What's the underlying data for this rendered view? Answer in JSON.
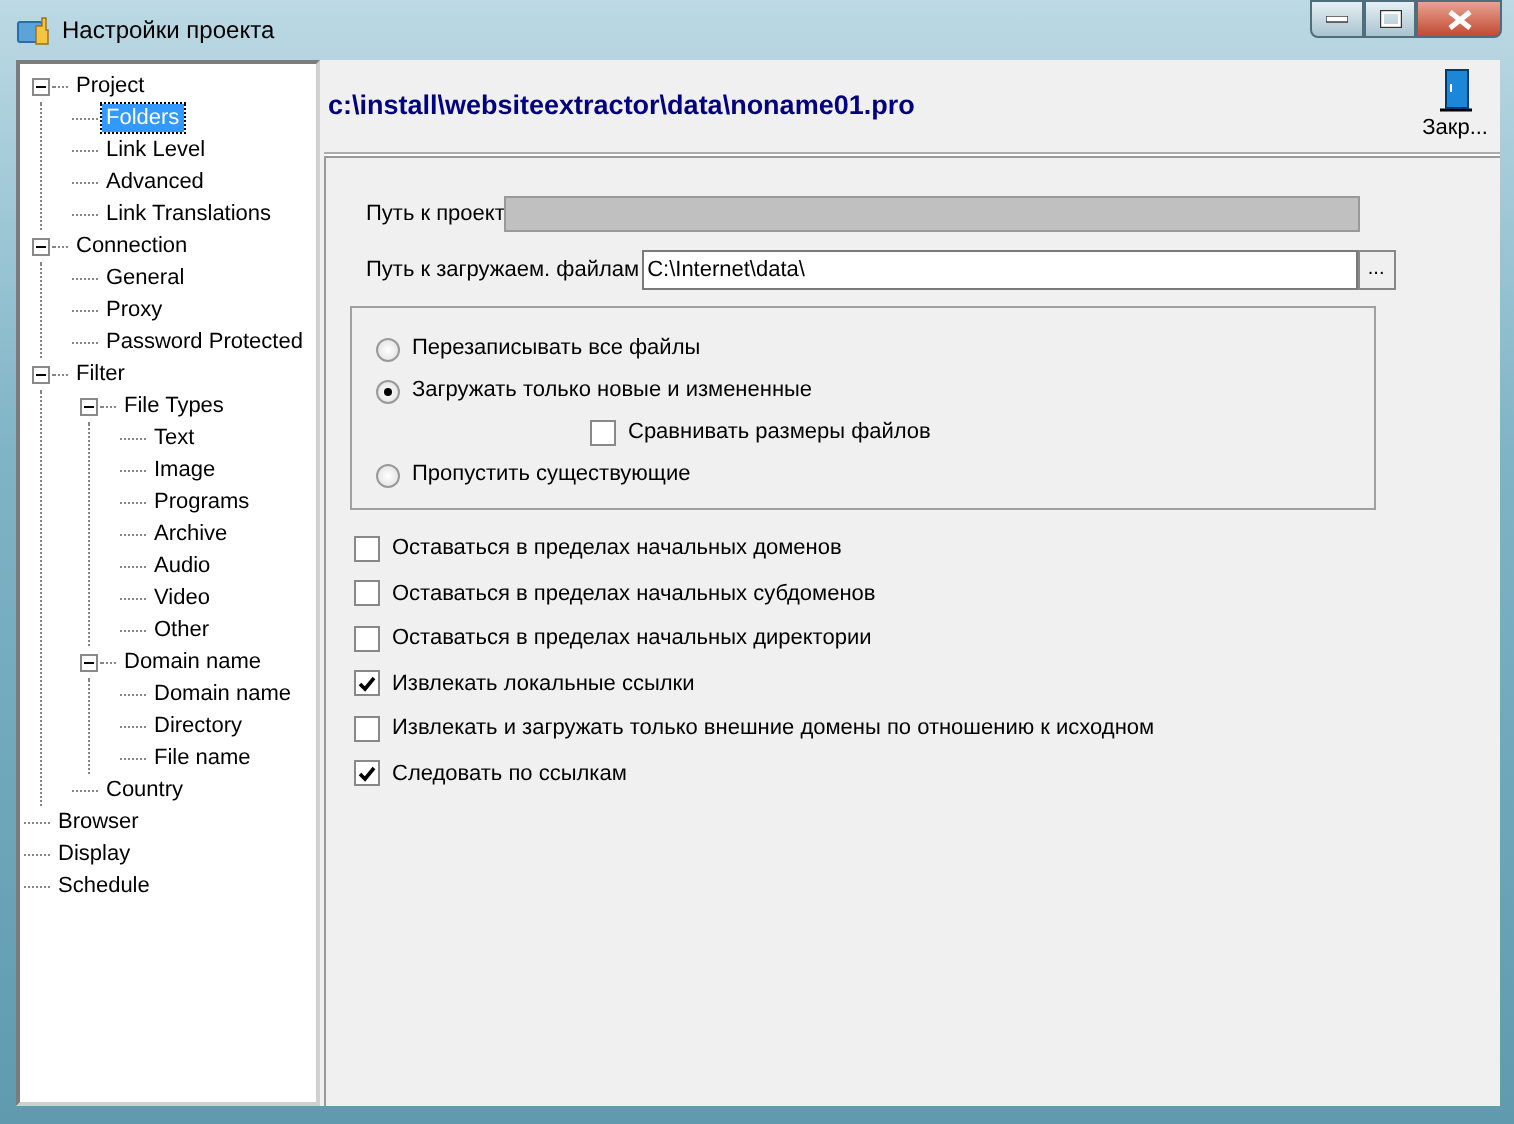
{
  "window": {
    "title": "Настройки проекта"
  },
  "tree": [
    {
      "label": "Project",
      "expanded": true,
      "selected": false,
      "children": [
        {
          "label": "Folders",
          "selected": true
        },
        {
          "label": "Link Level",
          "selected": false
        },
        {
          "label": "Advanced",
          "selected": false
        },
        {
          "label": "Link Translations",
          "selected": false
        }
      ]
    },
    {
      "label": "Connection",
      "expanded": true,
      "selected": false,
      "children": [
        {
          "label": "General",
          "selected": false
        },
        {
          "label": "Proxy",
          "selected": false
        },
        {
          "label": "Password Protected",
          "selected": false
        }
      ]
    },
    {
      "label": "Filter",
      "expanded": true,
      "selected": false,
      "children": [
        {
          "label": "File Types",
          "expanded": true,
          "selected": false,
          "children": [
            {
              "label": "Text",
              "selected": false
            },
            {
              "label": "Image",
              "selected": false
            },
            {
              "label": "Programs",
              "selected": false
            },
            {
              "label": "Archive",
              "selected": false
            },
            {
              "label": "Audio",
              "selected": false
            },
            {
              "label": "Video",
              "selected": false
            },
            {
              "label": "Other",
              "selected": false
            }
          ]
        },
        {
          "label": "Domain name",
          "expanded": true,
          "selected": false,
          "children": [
            {
              "label": "Domain name",
              "selected": false
            },
            {
              "label": "Directory",
              "selected": false
            },
            {
              "label": "File name",
              "selected": false
            }
          ]
        },
        {
          "label": "Country",
          "selected": false
        }
      ]
    },
    {
      "label": "Browser",
      "selected": false
    },
    {
      "label": "Display",
      "selected": false
    },
    {
      "label": "Schedule",
      "selected": false
    }
  ],
  "header": {
    "path": "c:\\install\\websiteextractor\\data\\noname01.pro",
    "close_button": "Закр..."
  },
  "fields": [
    {
      "label": "Путь к проект",
      "disabled": true
    },
    {
      "label": "Путь к загружаем. файлам",
      "value": "C:\\Internet\\data\\",
      "disabled": false,
      "browse_button": "..."
    }
  ],
  "overwrite_options": [
    {
      "label": "Перезаписывать все файлы",
      "selected": false
    },
    {
      "label": "Загружать только новые и измененные",
      "selected": true,
      "sub_option": {
        "label": "Сравнивать размеры файлов",
        "checked": false
      }
    },
    {
      "label": "Пропустить существующие",
      "selected": false
    }
  ],
  "checkboxes": [
    {
      "label": "Оставаться в пределах начальных доменов",
      "checked": false
    },
    {
      "label": "Оставаться в пределах начальных субдоменов",
      "checked": false
    },
    {
      "label": "Оставаться в пределах начальных директории",
      "checked": false
    },
    {
      "label": "Извлекать локальные ссылки",
      "checked": true
    },
    {
      "label": "Извлекать и загружать только внешние домены по отношению к исходном",
      "checked": false
    },
    {
      "label": "Следовать по ссылкам",
      "checked": true
    }
  ]
}
